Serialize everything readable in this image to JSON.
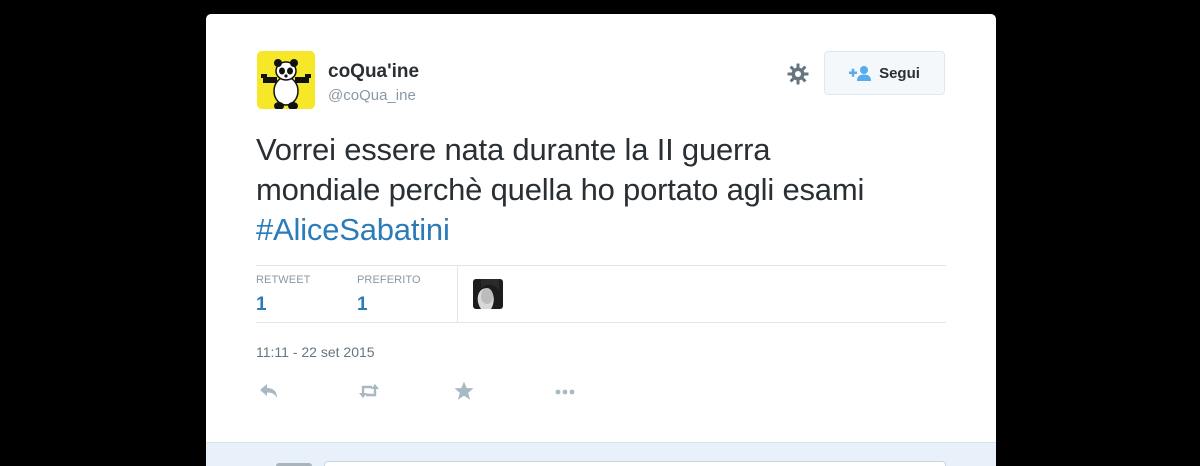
{
  "user": {
    "name": "coQua'ine",
    "handle": "@coQua_ine"
  },
  "header": {
    "settings_icon": "gear-icon",
    "follow_icon": "add-user-icon",
    "follow_label": "Segui"
  },
  "tweet": {
    "text_line1": "Vorrei essere nata durante la II guerra",
    "text_line2": "mondiale perchè quella ho portato agli esami",
    "hashtag": "#AliceSabatini"
  },
  "stats": {
    "retweet_label": "RETWEET",
    "retweet_count": "1",
    "favorite_label": "PREFERITO",
    "favorite_count": "1"
  },
  "timestamp": "11:11 - 22 set 2015",
  "actions": [
    {
      "icon": "reply-icon"
    },
    {
      "icon": "retweet-icon"
    },
    {
      "icon": "star-icon"
    },
    {
      "icon": "more-icon"
    }
  ],
  "colors": {
    "link": "#2b7bb9",
    "text": "#292f33",
    "muted": "#8899a6",
    "avatar_bg": "#f6e829"
  }
}
